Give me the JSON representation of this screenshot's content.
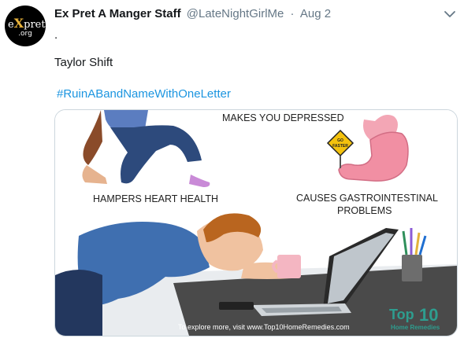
{
  "tweet": {
    "author_name": "Ex Pret A Manger Staff",
    "handle": "@LateNightGirlMe",
    "separator": "·",
    "date": "Aug 2",
    "text_line1": ".",
    "text_line2": "Taylor Shift",
    "hashtag": "#RuinABandNameWithOneLetter"
  },
  "avatar": {
    "logo_e": "e",
    "logo_x": "X",
    "logo_rest": "pret",
    "logo_sub": ".org"
  },
  "icons": {
    "caret": "chevron-down-icon"
  },
  "media": {
    "label_depressed": "MAKES YOU DEPRESSED",
    "label_heart": "HAMPERS HEART HEALTH",
    "label_gi_1": "CAUSES GASTROINTESTINAL",
    "label_gi_2": "PROBLEMS",
    "sign_1": "GO",
    "sign_2": "FASTER",
    "footer": "To explore more, visit www.Top10HomeRemedies.com",
    "brand_1": "Top",
    "brand_2": "10",
    "brand_3": "Home Remedies"
  },
  "colors": {
    "link": "#1b95e0",
    "muted": "#657786",
    "text": "#14171a"
  }
}
